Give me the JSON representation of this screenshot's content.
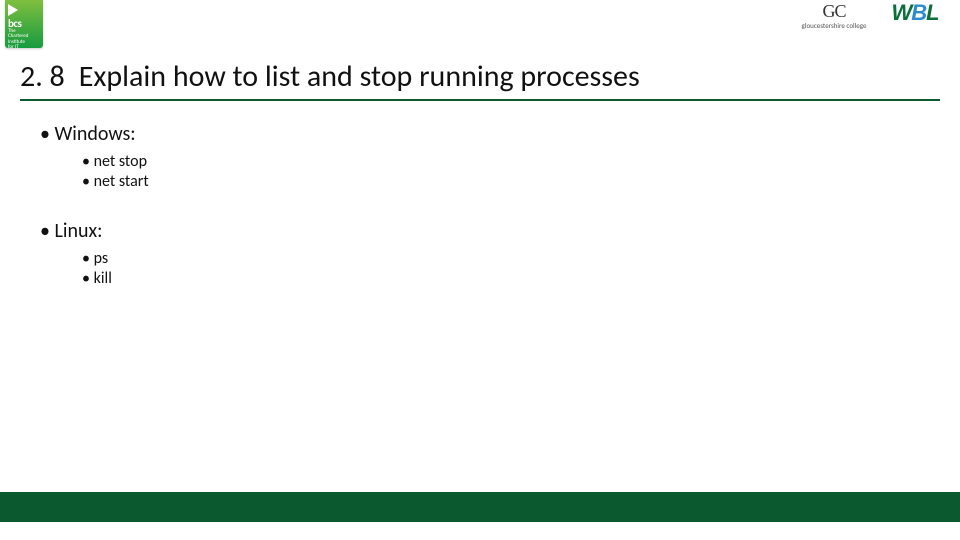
{
  "logos": {
    "bcs": {
      "name": "bcs",
      "sub1": "The",
      "sub2": "Chartered",
      "sub3": "Institute",
      "sub4": "for IT"
    },
    "gc": {
      "big": "GC",
      "sub": "gloucestershire college"
    },
    "wbl": {
      "w": "W",
      "b": "B",
      "l": "L"
    }
  },
  "title": {
    "number": "2. 8",
    "text": "Explain how to list and stop running processes"
  },
  "bullets": {
    "windows": {
      "label": "Windows:",
      "items": [
        "net stop",
        "net start"
      ]
    },
    "linux": {
      "label": "Linux:",
      "items": [
        "ps",
        "kill"
      ]
    }
  }
}
